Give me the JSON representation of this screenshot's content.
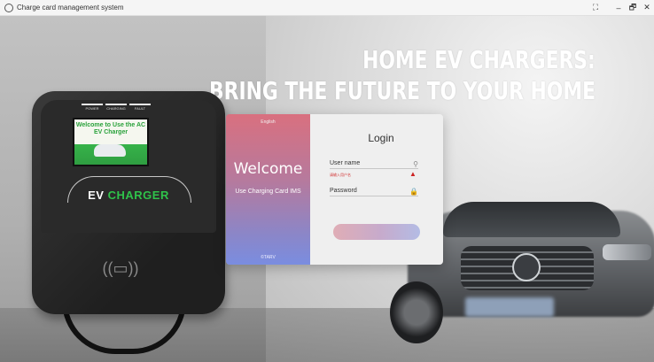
{
  "window": {
    "title": "Charge card management system",
    "controls": {
      "fullscreen": "⛶",
      "minimize": "–",
      "restore": "🗗",
      "close": "✕"
    }
  },
  "hero": {
    "line1": "HOME EV CHARGERS:",
    "line2": "BRING THE FUTURE TO YOUR HOME"
  },
  "charger_device": {
    "indicators": [
      "POWER",
      "CHARGING",
      "FAULT"
    ],
    "screen_text": "Welcome to Use the AC EV Charger",
    "logo_part1": "EV ",
    "logo_part2": "CHARGER"
  },
  "login": {
    "language": "English",
    "welcome": "Welcome",
    "subtitle": "Use Charging Card IMS",
    "brand": "©TARV",
    "title": "Login",
    "username_placeholder": "User name",
    "username_error": "请输入用户名",
    "password_placeholder": "Password",
    "login_button": ""
  },
  "icons": {
    "app": "app-logo-icon",
    "user": "user-icon",
    "lock": "lock-icon",
    "warning": "warning-icon"
  },
  "colors": {
    "accent_gradient_start": "#d9707f",
    "accent_gradient_end": "#7a8de0",
    "error": "#d23333",
    "ev_green": "#2fc24a"
  }
}
